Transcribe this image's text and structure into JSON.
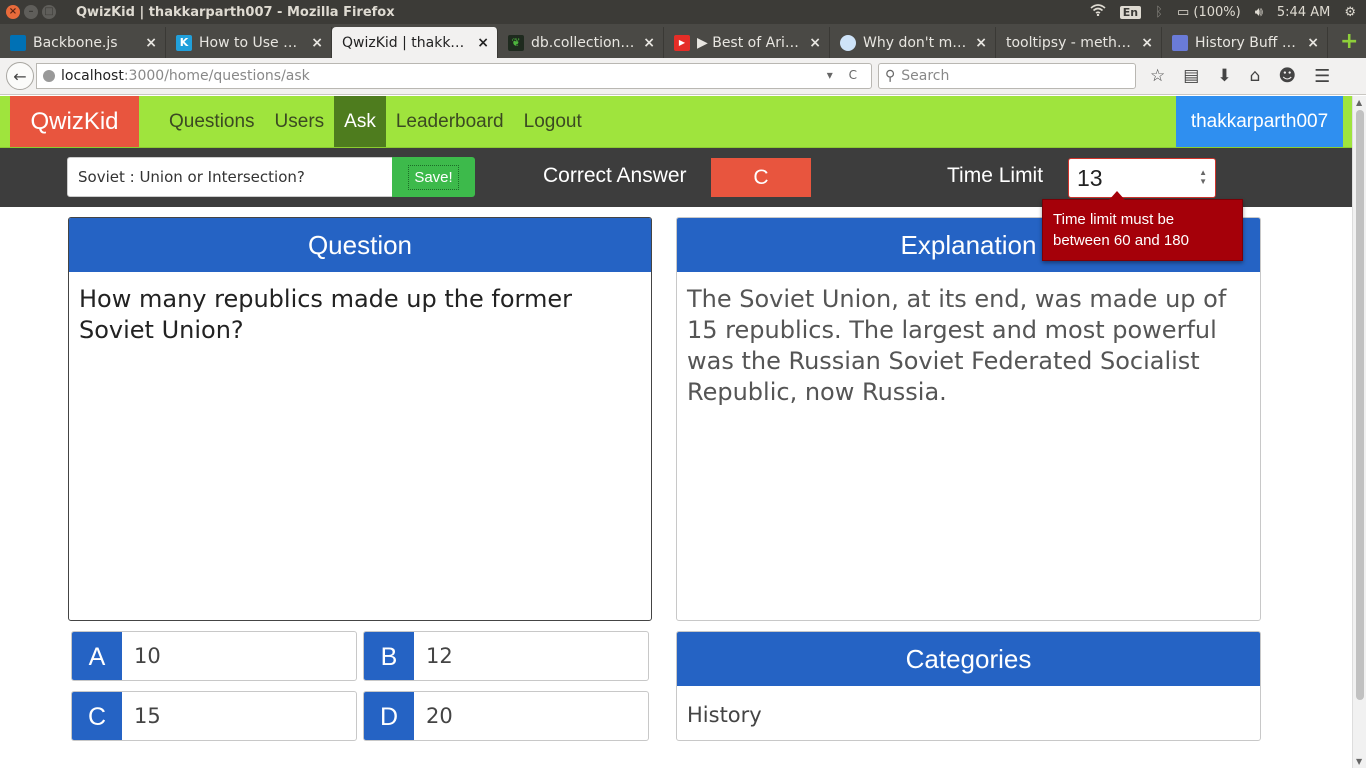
{
  "os": {
    "window_title": "QwizKid | thakkarparth007 - Mozilla Firefox",
    "keyboard": "En",
    "battery": "(100%)",
    "time": "5:44 AM"
  },
  "tabs": [
    {
      "label": "Backbone.js",
      "icon": "backbone-favicon",
      "color": "#0071b5",
      "glyph": ""
    },
    {
      "label": "How to Use n…",
      "icon": "k-favicon",
      "color": "#21a0db",
      "glyph": "K"
    },
    {
      "label": "QwizKid | thakka…",
      "icon": "page-favicon",
      "color": "#f2f1f0",
      "glyph": "",
      "active": true
    },
    {
      "label": "db.collection…",
      "icon": "mongodb-leaf-favicon",
      "color": "#1e2a1e",
      "glyph": ""
    },
    {
      "label": "▶ Best of Arij…",
      "icon": "youtube-favicon",
      "color": "#e52d27",
      "glyph": "▶"
    },
    {
      "label": "Why don't m…",
      "icon": "reddit-favicon",
      "color": "#cee3f8",
      "glyph": ""
    },
    {
      "label": "tooltipsy - meth…",
      "icon": "blank-favicon",
      "color": "#4a4945",
      "glyph": ""
    },
    {
      "label": "History Buff …",
      "icon": "history-buff-favicon",
      "color": "#6a7bd8",
      "glyph": ""
    }
  ],
  "browser": {
    "url_host": "localhost",
    "url_path": ":3000/home/questions/ask",
    "search_placeholder": "Search"
  },
  "app": {
    "brand": "QwizKid",
    "nav": [
      "Questions",
      "Users",
      "Ask",
      "Leaderboard",
      "Logout"
    ],
    "active_nav": "Ask",
    "username": "thakkarparth007",
    "colors": {
      "brand": "#e8553e",
      "navbar": "#9fe43d",
      "panel": "#2563c4",
      "user": "#2f8ff0"
    }
  },
  "editor": {
    "title_value": "Soviet : Union or Intersection?",
    "save_label": "Save!",
    "correct_answer_label": "Correct Answer",
    "correct_answer_value": "C",
    "time_limit_label": "Time Limit",
    "time_limit_value": "13",
    "tooltip": "Time limit must be between 60 and 180"
  },
  "question": {
    "heading": "Question",
    "text": "How many republics made up the former Soviet Union?"
  },
  "explanation": {
    "heading": "Explanation",
    "text": "The Soviet Union, at its end, was made up of 15 republics. The largest and most powerful was the Russian Soviet Federated Socialist Republic, now Russia."
  },
  "options": [
    {
      "letter": "A",
      "value": "10"
    },
    {
      "letter": "B",
      "value": "12"
    },
    {
      "letter": "C",
      "value": "15"
    },
    {
      "letter": "D",
      "value": "20"
    }
  ],
  "categories": {
    "heading": "Categories",
    "value": "History"
  }
}
